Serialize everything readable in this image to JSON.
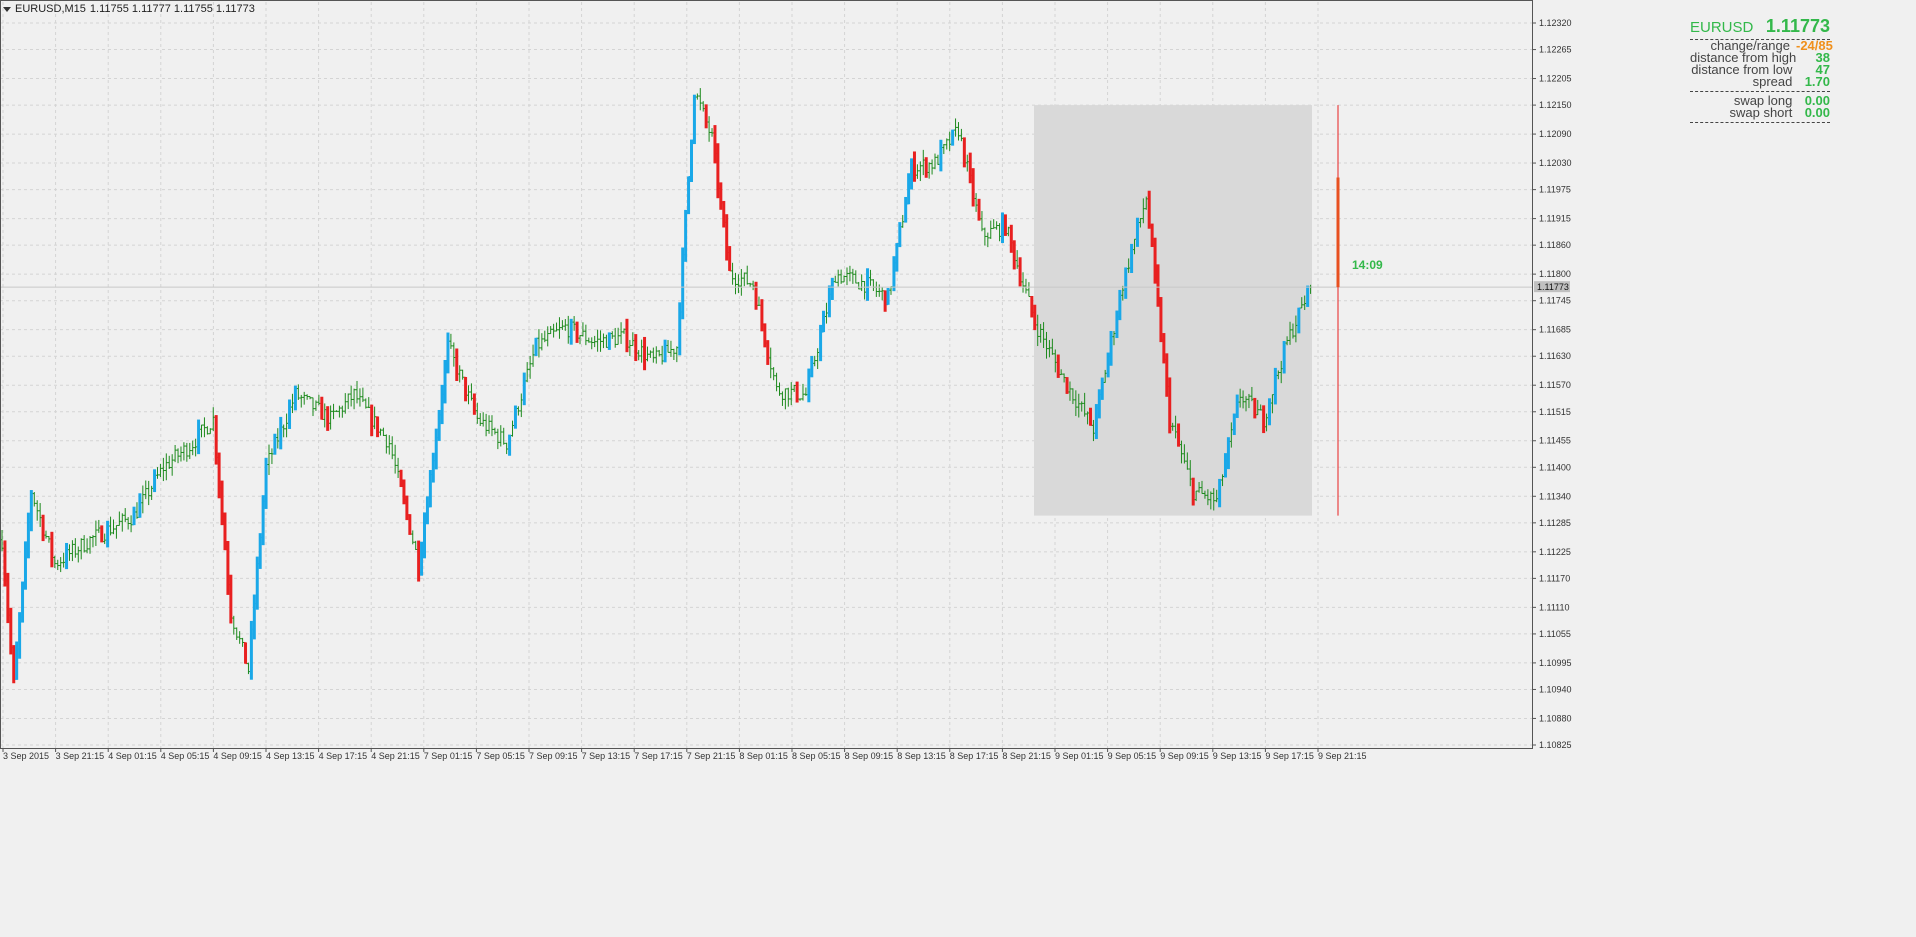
{
  "header": {
    "symbol_tf": "EURUSD,M15",
    "ohlc": "1.11755 1.11777 1.11755 1.11773"
  },
  "info_panel": {
    "symbol": "EURUSD",
    "price": "1.11773",
    "rows_a": [
      {
        "label": "change/range",
        "value": "-24/85",
        "accent": "orange"
      },
      {
        "label": "distance from high",
        "value": "38"
      },
      {
        "label": "distance from low",
        "value": "47"
      },
      {
        "label": "spread",
        "value": "1.70"
      }
    ],
    "rows_b": [
      {
        "label": "swap long",
        "value": "0.00"
      },
      {
        "label": "swap short",
        "value": "0.00"
      }
    ]
  },
  "countdown": "14:09",
  "colors": {
    "bull": "#1aa8e8",
    "bear": "#e82020",
    "bar": "#1d8a1d",
    "accent_text": "#33b84a",
    "orange": "#f0901c",
    "range_box": "#d9d9d9"
  },
  "chart_data": {
    "type": "ohlc",
    "symbol": "EURUSD",
    "timeframe": "M15",
    "ylim": [
      1.10825,
      1.1232
    ],
    "y_ticks": [
      "1.12320",
      "1.12265",
      "1.12205",
      "1.12150",
      "1.12090",
      "1.12030",
      "1.11975",
      "1.11915",
      "1.11860",
      "1.11800",
      "1.11745",
      "1.11685",
      "1.11630",
      "1.11570",
      "1.11515",
      "1.11455",
      "1.11400",
      "1.11340",
      "1.11285",
      "1.11225",
      "1.11170",
      "1.11110",
      "1.11055",
      "1.10995",
      "1.10940",
      "1.10880",
      "1.10825"
    ],
    "x_labels": [
      "3 Sep 2015",
      "3 Sep 21:15",
      "4 Sep 01:15",
      "4 Sep 05:15",
      "4 Sep 09:15",
      "4 Sep 13:15",
      "4 Sep 17:15",
      "4 Sep 21:15",
      "7 Sep 01:15",
      "7 Sep 05:15",
      "7 Sep 09:15",
      "7 Sep 13:15",
      "7 Sep 17:15",
      "7 Sep 21:15",
      "8 Sep 01:15",
      "8 Sep 05:15",
      "8 Sep 09:15",
      "8 Sep 13:15",
      "8 Sep 17:15",
      "8 Sep 21:15",
      "9 Sep 01:15",
      "9 Sep 05:15",
      "9 Sep 09:15",
      "9 Sep 13:15",
      "9 Sep 17:15",
      "9 Sep 21:15"
    ],
    "current_price": "1.11773",
    "day_range": {
      "high": 1.1215,
      "low": 1.113
    },
    "anchors": [
      [
        0,
        1.1125
      ],
      [
        4,
        1.1095
      ],
      [
        10,
        1.1135
      ],
      [
        18,
        1.112
      ],
      [
        30,
        1.1125
      ],
      [
        45,
        1.113
      ],
      [
        55,
        1.114
      ],
      [
        65,
        1.1145
      ],
      [
        72,
        1.115
      ],
      [
        78,
        1.111
      ],
      [
        84,
        1.1098
      ],
      [
        90,
        1.114
      ],
      [
        100,
        1.1155
      ],
      [
        112,
        1.115
      ],
      [
        120,
        1.1155
      ],
      [
        132,
        1.1145
      ],
      [
        142,
        1.112
      ],
      [
        152,
        1.1165
      ],
      [
        162,
        1.115
      ],
      [
        172,
        1.1145
      ],
      [
        182,
        1.1165
      ],
      [
        192,
        1.1169
      ],
      [
        202,
        1.1166
      ],
      [
        212,
        1.1167
      ],
      [
        222,
        1.1162
      ],
      [
        230,
        1.1165
      ],
      [
        236,
        1.1218
      ],
      [
        242,
        1.1208
      ],
      [
        248,
        1.118
      ],
      [
        256,
        1.1178
      ],
      [
        264,
        1.1156
      ],
      [
        274,
        1.1155
      ],
      [
        284,
        1.118
      ],
      [
        294,
        1.1178
      ],
      [
        302,
        1.1175
      ],
      [
        310,
        1.1202
      ],
      [
        318,
        1.1203
      ],
      [
        326,
        1.121
      ],
      [
        334,
        1.1188
      ],
      [
        342,
        1.119
      ],
      [
        352,
        1.117
      ],
      [
        362,
        1.1158
      ],
      [
        372,
        1.1148
      ],
      [
        382,
        1.1178
      ],
      [
        390,
        1.1196
      ],
      [
        398,
        1.115
      ],
      [
        406,
        1.1135
      ],
      [
        414,
        1.1133
      ],
      [
        422,
        1.1155
      ],
      [
        430,
        1.115
      ],
      [
        438,
        1.1166
      ],
      [
        446,
        1.11773
      ]
    ]
  }
}
